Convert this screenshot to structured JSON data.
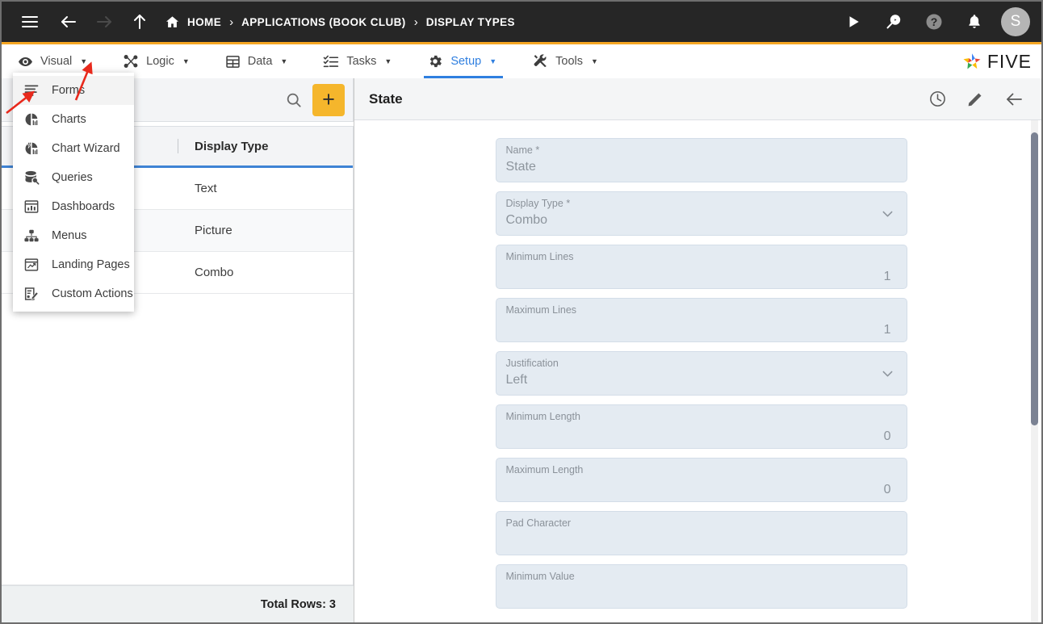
{
  "topbar": {
    "icons": {
      "menu": "hamburger-icon",
      "back": "back-arrow-icon",
      "forward": "forward-arrow-icon",
      "up": "up-arrow-icon",
      "home": "home-icon",
      "run": "play-icon",
      "search": "search-play-icon",
      "help": "help-icon",
      "notifications": "bell-icon"
    },
    "breadcrumbs": [
      {
        "label": "HOME",
        "icon": "home-icon"
      },
      {
        "label": "APPLICATIONS (BOOK CLUB)"
      },
      {
        "label": "DISPLAY TYPES"
      }
    ],
    "separator": "›",
    "avatar_initial": "S"
  },
  "menubar": {
    "items": [
      {
        "label": "Visual",
        "icon": "eye-icon",
        "active": false,
        "open": true
      },
      {
        "label": "Logic",
        "icon": "logic-nodes-icon",
        "active": false
      },
      {
        "label": "Data",
        "icon": "table-grid-icon",
        "active": false
      },
      {
        "label": "Tasks",
        "icon": "tasks-checklist-icon",
        "active": false
      },
      {
        "label": "Setup",
        "icon": "gear-icon",
        "active": true
      },
      {
        "label": "Tools",
        "icon": "tools-wrench-icon",
        "active": false
      }
    ],
    "caret": "▼",
    "logo_text": "FIVE"
  },
  "visual_menu": {
    "items": [
      {
        "label": "Forms",
        "icon": "forms-lines-icon",
        "hovered": true
      },
      {
        "label": "Charts",
        "icon": "pie-chart-icon",
        "hovered": false
      },
      {
        "label": "Chart Wizard",
        "icon": "chart-wizard-icon",
        "hovered": false
      },
      {
        "label": "Queries",
        "icon": "database-search-icon",
        "hovered": false
      },
      {
        "label": "Dashboards",
        "icon": "dashboard-icon",
        "hovered": false
      },
      {
        "label": "Menus",
        "icon": "menu-tree-icon",
        "hovered": false
      },
      {
        "label": "Landing Pages",
        "icon": "landing-page-icon",
        "hovered": false
      },
      {
        "label": "Custom Actions",
        "icon": "custom-action-icon",
        "hovered": false
      }
    ]
  },
  "left_panel": {
    "search": {
      "placeholder": "",
      "value": "",
      "icon": "search-icon"
    },
    "add_button": {
      "label": "+",
      "icon": "plus-icon"
    },
    "grid": {
      "columns": [
        "",
        "Display Type"
      ],
      "rows": [
        {
          "col1": "",
          "col2": "Text"
        },
        {
          "col1": "",
          "col2": "Picture"
        },
        {
          "col1": "",
          "col2": "Combo"
        }
      ]
    },
    "footer": {
      "total_rows_label": "Total Rows: 3"
    }
  },
  "right_panel": {
    "title": "State",
    "actions": [
      {
        "name": "history-icon",
        "label": "History"
      },
      {
        "name": "edit-pencil-icon",
        "label": "Edit"
      },
      {
        "name": "back-arrow-icon",
        "label": "Back"
      }
    ],
    "fields": [
      {
        "label": "Name",
        "required": true,
        "value": "State",
        "type": "text",
        "align": "left"
      },
      {
        "label": "Display Type",
        "required": true,
        "value": "Combo",
        "type": "select",
        "align": "left"
      },
      {
        "label": "Minimum Lines",
        "required": false,
        "value": "1",
        "type": "number",
        "align": "right"
      },
      {
        "label": "Maximum Lines",
        "required": false,
        "value": "1",
        "type": "number",
        "align": "right"
      },
      {
        "label": "Justification",
        "required": false,
        "value": "Left",
        "type": "select",
        "align": "left"
      },
      {
        "label": "Minimum Length",
        "required": false,
        "value": "0",
        "type": "number",
        "align": "right"
      },
      {
        "label": "Maximum Length",
        "required": false,
        "value": "0",
        "type": "number",
        "align": "right"
      },
      {
        "label": "Pad Character",
        "required": false,
        "value": "",
        "type": "text",
        "align": "left"
      },
      {
        "label": "Minimum Value",
        "required": false,
        "value": "",
        "type": "text",
        "align": "left"
      }
    ]
  },
  "colors": {
    "topbar_bg": "#262626",
    "accent_orange": "#f5a623",
    "accent_blue": "#2f7fe0",
    "field_bg": "#e4ebf2",
    "add_button": "#f5b62c",
    "annotation_arrow": "#e8291c"
  }
}
